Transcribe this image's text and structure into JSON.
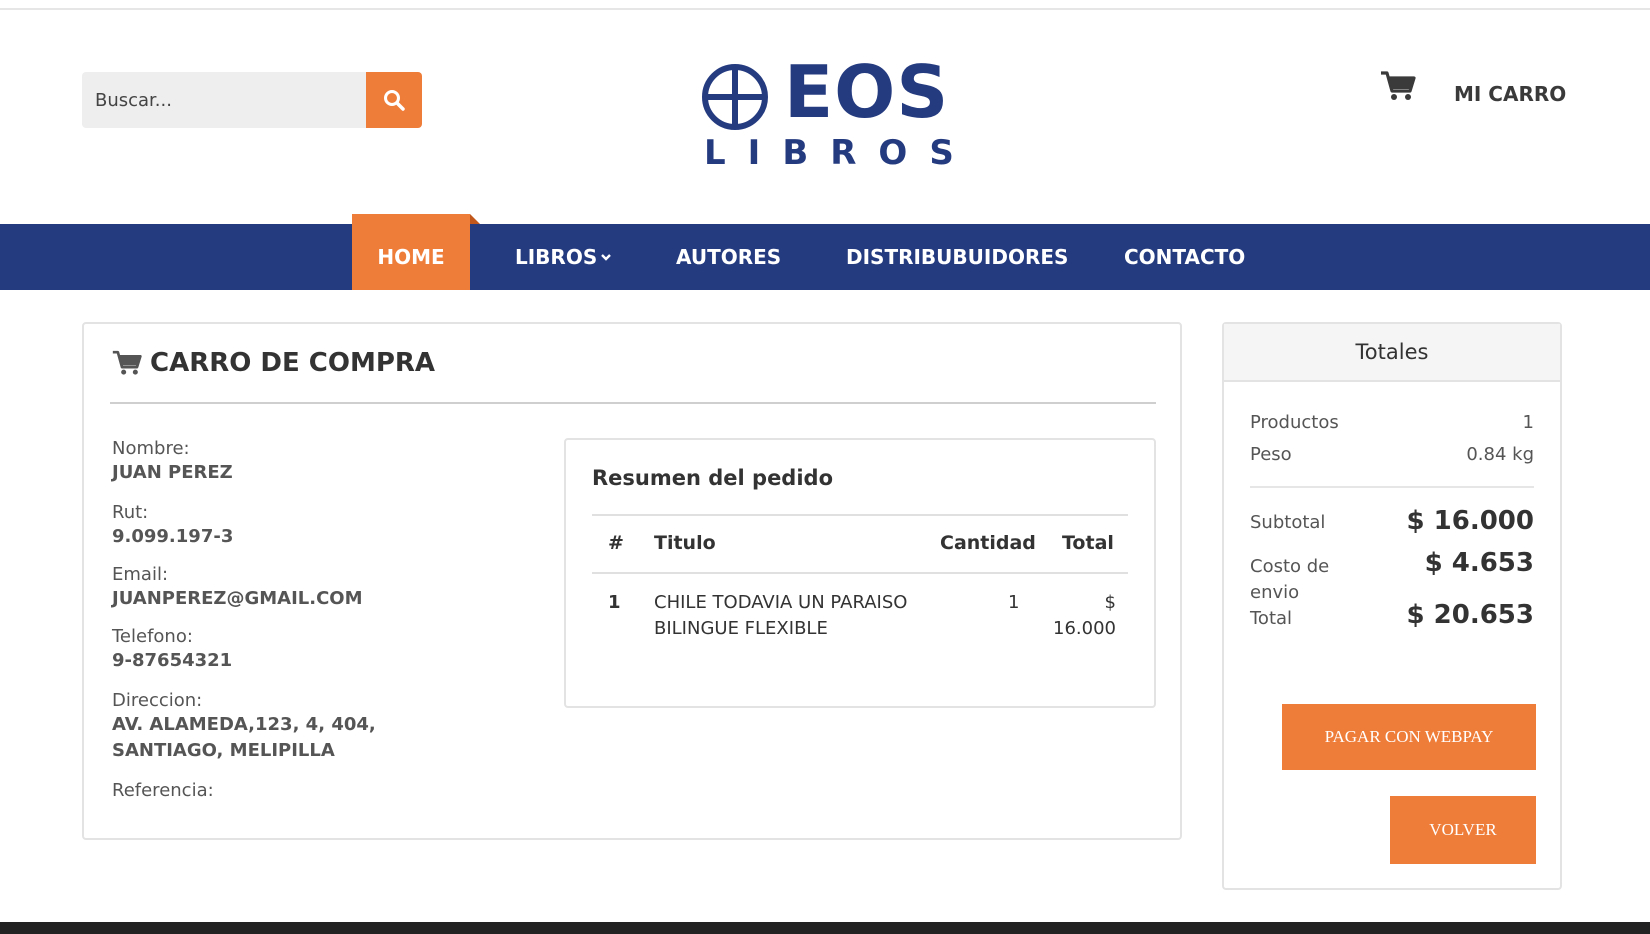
{
  "header": {
    "search_placeholder": "Buscar...",
    "logo_word": "EOS",
    "logo_sub": "LIBROS",
    "cart_label": "MI CARRO"
  },
  "nav": {
    "home": "HOME",
    "libros": "LIBROS",
    "autores": "AUTORES",
    "distribuidores": "DISTRIBUBUIDORES",
    "contacto": "CONTACTO"
  },
  "cart": {
    "title": "CARRO DE COMPRA",
    "fields": {
      "nombre_label": "Nombre:",
      "nombre": "JUAN PEREZ",
      "rut_label": "Rut:",
      "rut": "9.099.197-3",
      "email_label": "Email:",
      "email": "JUANPEREZ@GMAIL.COM",
      "telefono_label": "Telefono:",
      "telefono": "9-87654321",
      "direccion_label": "Direccion:",
      "direccion_line1": "AV. ALAMEDA,123, 4, 404,",
      "direccion_line2": "SANTIAGO, MELIPILLA",
      "referencia_label": "Referencia:"
    }
  },
  "summary": {
    "title": "Resumen del pedido",
    "columns": [
      "#",
      "Titulo",
      "Cantidad",
      "Total"
    ],
    "rows": [
      {
        "num": "1",
        "titulo_line1": "CHILE TODAVIA UN PARAISO",
        "titulo_line2": "BILINGUE FLEXIBLE",
        "cantidad": "1",
        "total_line1": "$",
        "total_line2": "16.000"
      }
    ]
  },
  "totals": {
    "title": "Totales",
    "productos_label": "Productos",
    "productos": "1",
    "peso_label": "Peso",
    "peso": "0.84 kg",
    "subtotal_label": "Subtotal",
    "subtotal": "$ 16.000",
    "envio_label_line1": "Costo de",
    "envio_label_line2": "envio",
    "envio": "$ 4.653",
    "total_label": "Total",
    "total": "$ 20.653",
    "pay_button": "PAGAR CON WEBPAY",
    "back_button": "VOLVER"
  },
  "colors": {
    "brand_blue": "#253b80",
    "accent_orange": "#ef7d3a"
  }
}
